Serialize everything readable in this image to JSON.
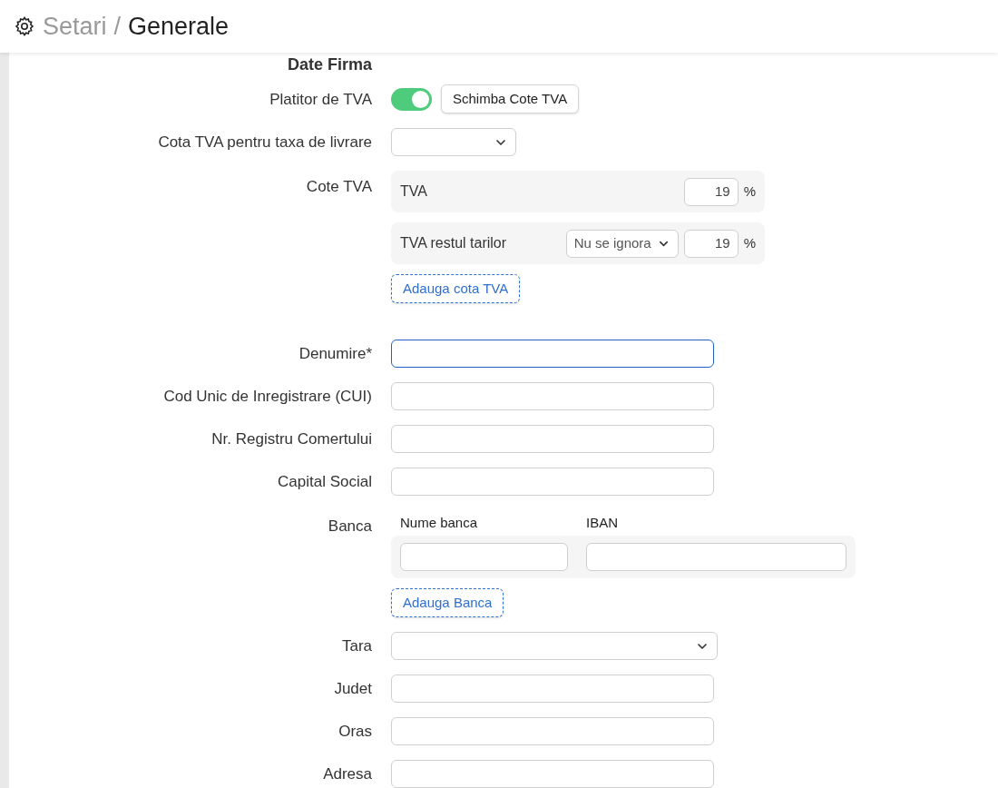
{
  "header": {
    "section": "Setari",
    "separator": "/",
    "page": "Generale"
  },
  "section_title": "Date Firma",
  "fields": [
    {
      "kind": "toggle",
      "label": "Platitor de TVA",
      "on": true,
      "button": "Schimba Cote TVA"
    },
    {
      "kind": "short_select",
      "label": "Cota TVA pentru taxa de livrare"
    },
    {
      "kind": "vat_rates",
      "label": "Cote TVA",
      "rates": [
        {
          "name": "TVA",
          "value": "19",
          "unit": "%"
        },
        {
          "name": "TVA restul tarilor",
          "option": "Nu se ignora",
          "value": "19",
          "unit": "%"
        }
      ],
      "add_button": "Adauga cota TVA"
    },
    {
      "kind": "text",
      "label": "Denumire*",
      "focused": true
    },
    {
      "kind": "text",
      "label": "Cod Unic de Inregistrare (CUI)",
      "focused": false
    },
    {
      "kind": "text",
      "label": "Nr. Registru Comertului",
      "focused": false
    },
    {
      "kind": "text",
      "label": "Capital Social",
      "focused": false
    },
    {
      "kind": "bank",
      "label": "Banca",
      "columns": [
        "Nume banca",
        "IBAN"
      ],
      "add_button": "Adauga Banca"
    },
    {
      "kind": "select",
      "label": "Tara"
    },
    {
      "kind": "text",
      "label": "Judet",
      "focused": false
    },
    {
      "kind": "text",
      "label": "Oras",
      "focused": false
    },
    {
      "kind": "text",
      "label": "Adresa",
      "focused": false
    }
  ]
}
